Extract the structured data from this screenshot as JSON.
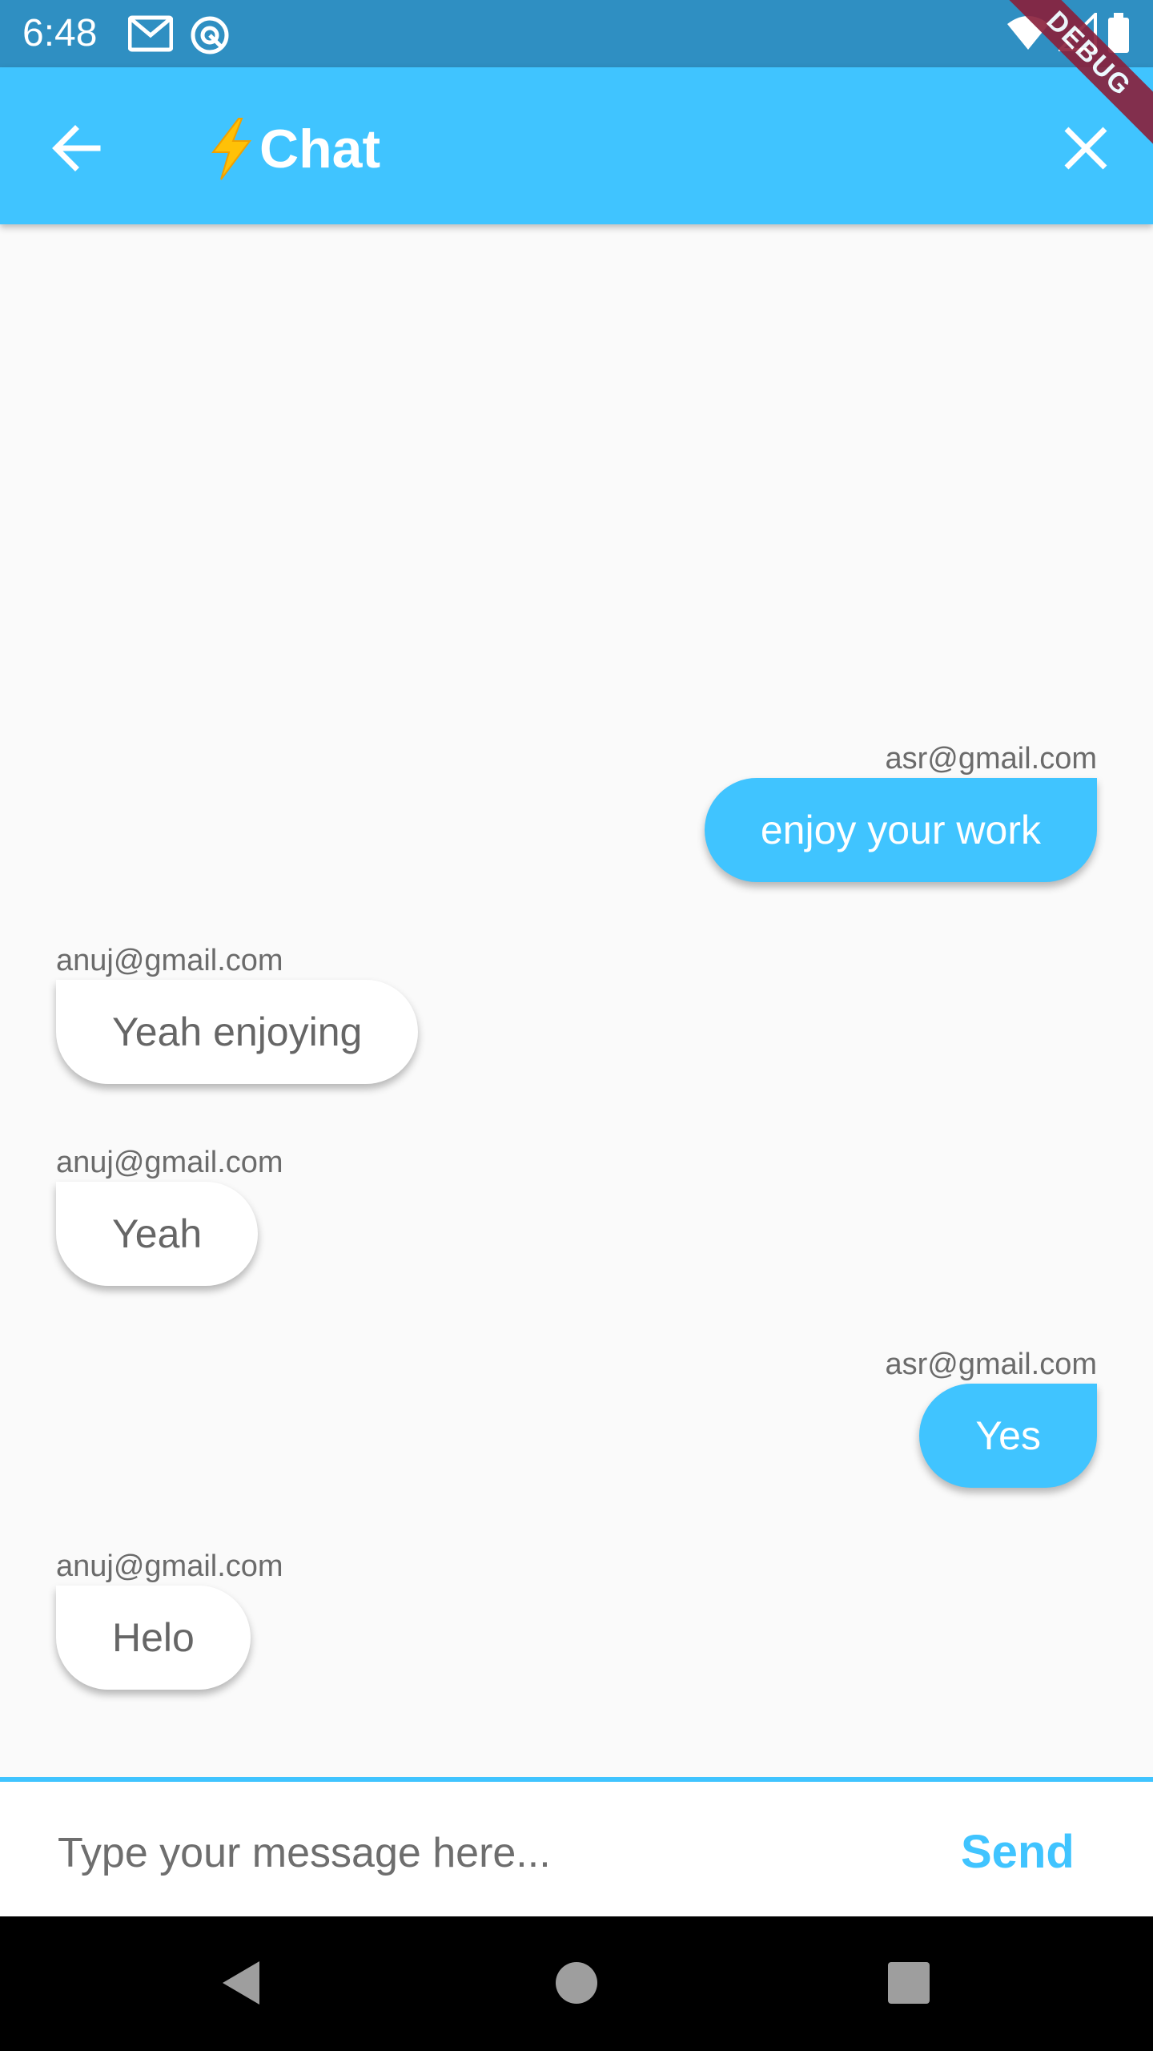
{
  "status_bar": {
    "time": "6:48",
    "icons": [
      "gmail-icon",
      "sync-icon",
      "wifi-icon",
      "signal-icon",
      "battery-icon"
    ]
  },
  "app_bar": {
    "title": "Chat",
    "title_emoji": "bolt-icon",
    "background": "#40c4ff",
    "debug_label": "DEBUG"
  },
  "messages": [
    {
      "sender": "asr@gmail.com",
      "text": "enjoy your work",
      "is_me": true
    },
    {
      "sender": "anuj@gmail.com",
      "text": "Yeah enjoying",
      "is_me": false
    },
    {
      "sender": "anuj@gmail.com",
      "text": "Yeah",
      "is_me": false
    },
    {
      "sender": "asr@gmail.com",
      "text": "Yes",
      "is_me": true
    },
    {
      "sender": "anuj@gmail.com",
      "text": "Helo",
      "is_me": false
    }
  ],
  "composer": {
    "placeholder": "Type your message here...",
    "value": "",
    "send_label": "Send",
    "accent": "#40c4ff"
  },
  "nav_bar": {
    "buttons": [
      "back-triangle-icon",
      "home-circle-icon",
      "recents-square-icon"
    ]
  }
}
